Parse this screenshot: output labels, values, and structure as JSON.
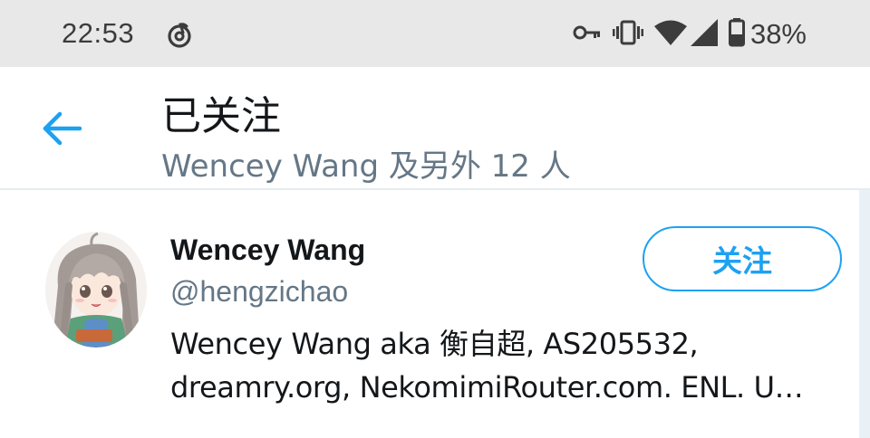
{
  "status_bar": {
    "time": "22:53",
    "app_icon": "netease-music-icon",
    "icons": [
      "key-icon",
      "vibrate-icon",
      "wifi-icon",
      "cell-signal-icon",
      "battery-icon"
    ],
    "battery_percent": "38%"
  },
  "header": {
    "back_icon": "arrow-left-icon",
    "title": "已关注",
    "subtitle": "Wencey Wang 及另外 12 人"
  },
  "users": [
    {
      "avatar_icon": "anime-girl-avatar",
      "name": "Wencey Wang",
      "handle": "@hengzichao",
      "bio": "Wencey Wang aka 衡自超, AS205532, dreamry.org, NekomimiRouter.com. ENL. U…",
      "follow_label": "关注"
    }
  ],
  "colors": {
    "accent": "#1da1f2",
    "text_primary": "#14171a",
    "text_secondary": "#657786",
    "status_bar_bg": "#e8e8e8",
    "divider": "#e6ecf0"
  }
}
